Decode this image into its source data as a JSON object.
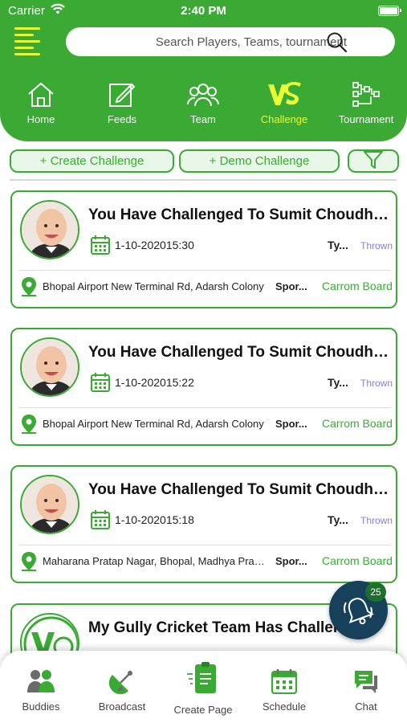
{
  "status_bar": {
    "carrier": "Carrier",
    "time": "2:40 PM"
  },
  "search": {
    "placeholder": "Search Players, Teams, tournament"
  },
  "top_nav": [
    {
      "label": "Home",
      "icon": "home-icon"
    },
    {
      "label": "Feeds",
      "icon": "edit-icon"
    },
    {
      "label": "Team",
      "icon": "team-icon"
    },
    {
      "label": "Challenge",
      "icon": "vs-icon",
      "active": true
    },
    {
      "label": "Tournament",
      "icon": "bracket-icon"
    }
  ],
  "actions": {
    "create_challenge": "+ Create Challenge",
    "demo_challenge": "+ Demo Challenge"
  },
  "cards": [
    {
      "title": "You Have Challenged To Sumit Choudhary",
      "datetime": "1-10-202015:30",
      "type_label": "Ty...",
      "type_value": "Thrown",
      "location": "Bhopal Airport New Terminal Rd, Adarsh Colony",
      "sport_label": "Spor...",
      "sport_value": "Carrom Board"
    },
    {
      "title": "You Have Challenged To Sumit Choudhary",
      "datetime": "1-10-202015:22",
      "type_label": "Ty...",
      "type_value": "Thrown",
      "location": "Bhopal Airport New Terminal Rd, Adarsh Colony",
      "sport_label": "Spor...",
      "sport_value": "Carrom Board"
    },
    {
      "title": "You Have Challenged To Sumit Choudhary",
      "datetime": "1-10-202015:18",
      "type_label": "Ty...",
      "type_value": "Thrown",
      "location": "Maharana Pratap Nagar, Bhopal, Madhya Pradesh",
      "sport_label": "Spor...",
      "sport_value": "Carrom Board"
    },
    {
      "title": "My Gully Cricket Team Has Challenged",
      "datetime": "",
      "type_label": "",
      "type_value": "",
      "location": "",
      "sport_label": "",
      "sport_value": ""
    }
  ],
  "notification": {
    "count": "25",
    "icon": "bell-icon"
  },
  "bottom_nav": [
    {
      "label": "Buddies",
      "icon": "buddies-icon"
    },
    {
      "label": "Broadcast",
      "icon": "satellite-icon"
    },
    {
      "label": "Create Page",
      "icon": "create-page-icon"
    },
    {
      "label": "Schedule",
      "icon": "calendar-icon"
    },
    {
      "label": "Chat",
      "icon": "chat-icon"
    }
  ],
  "colors": {
    "primary": "#3aaa35",
    "accent": "#e8ff36",
    "thrown": "#8a7dd6",
    "fab": "#17405a"
  }
}
